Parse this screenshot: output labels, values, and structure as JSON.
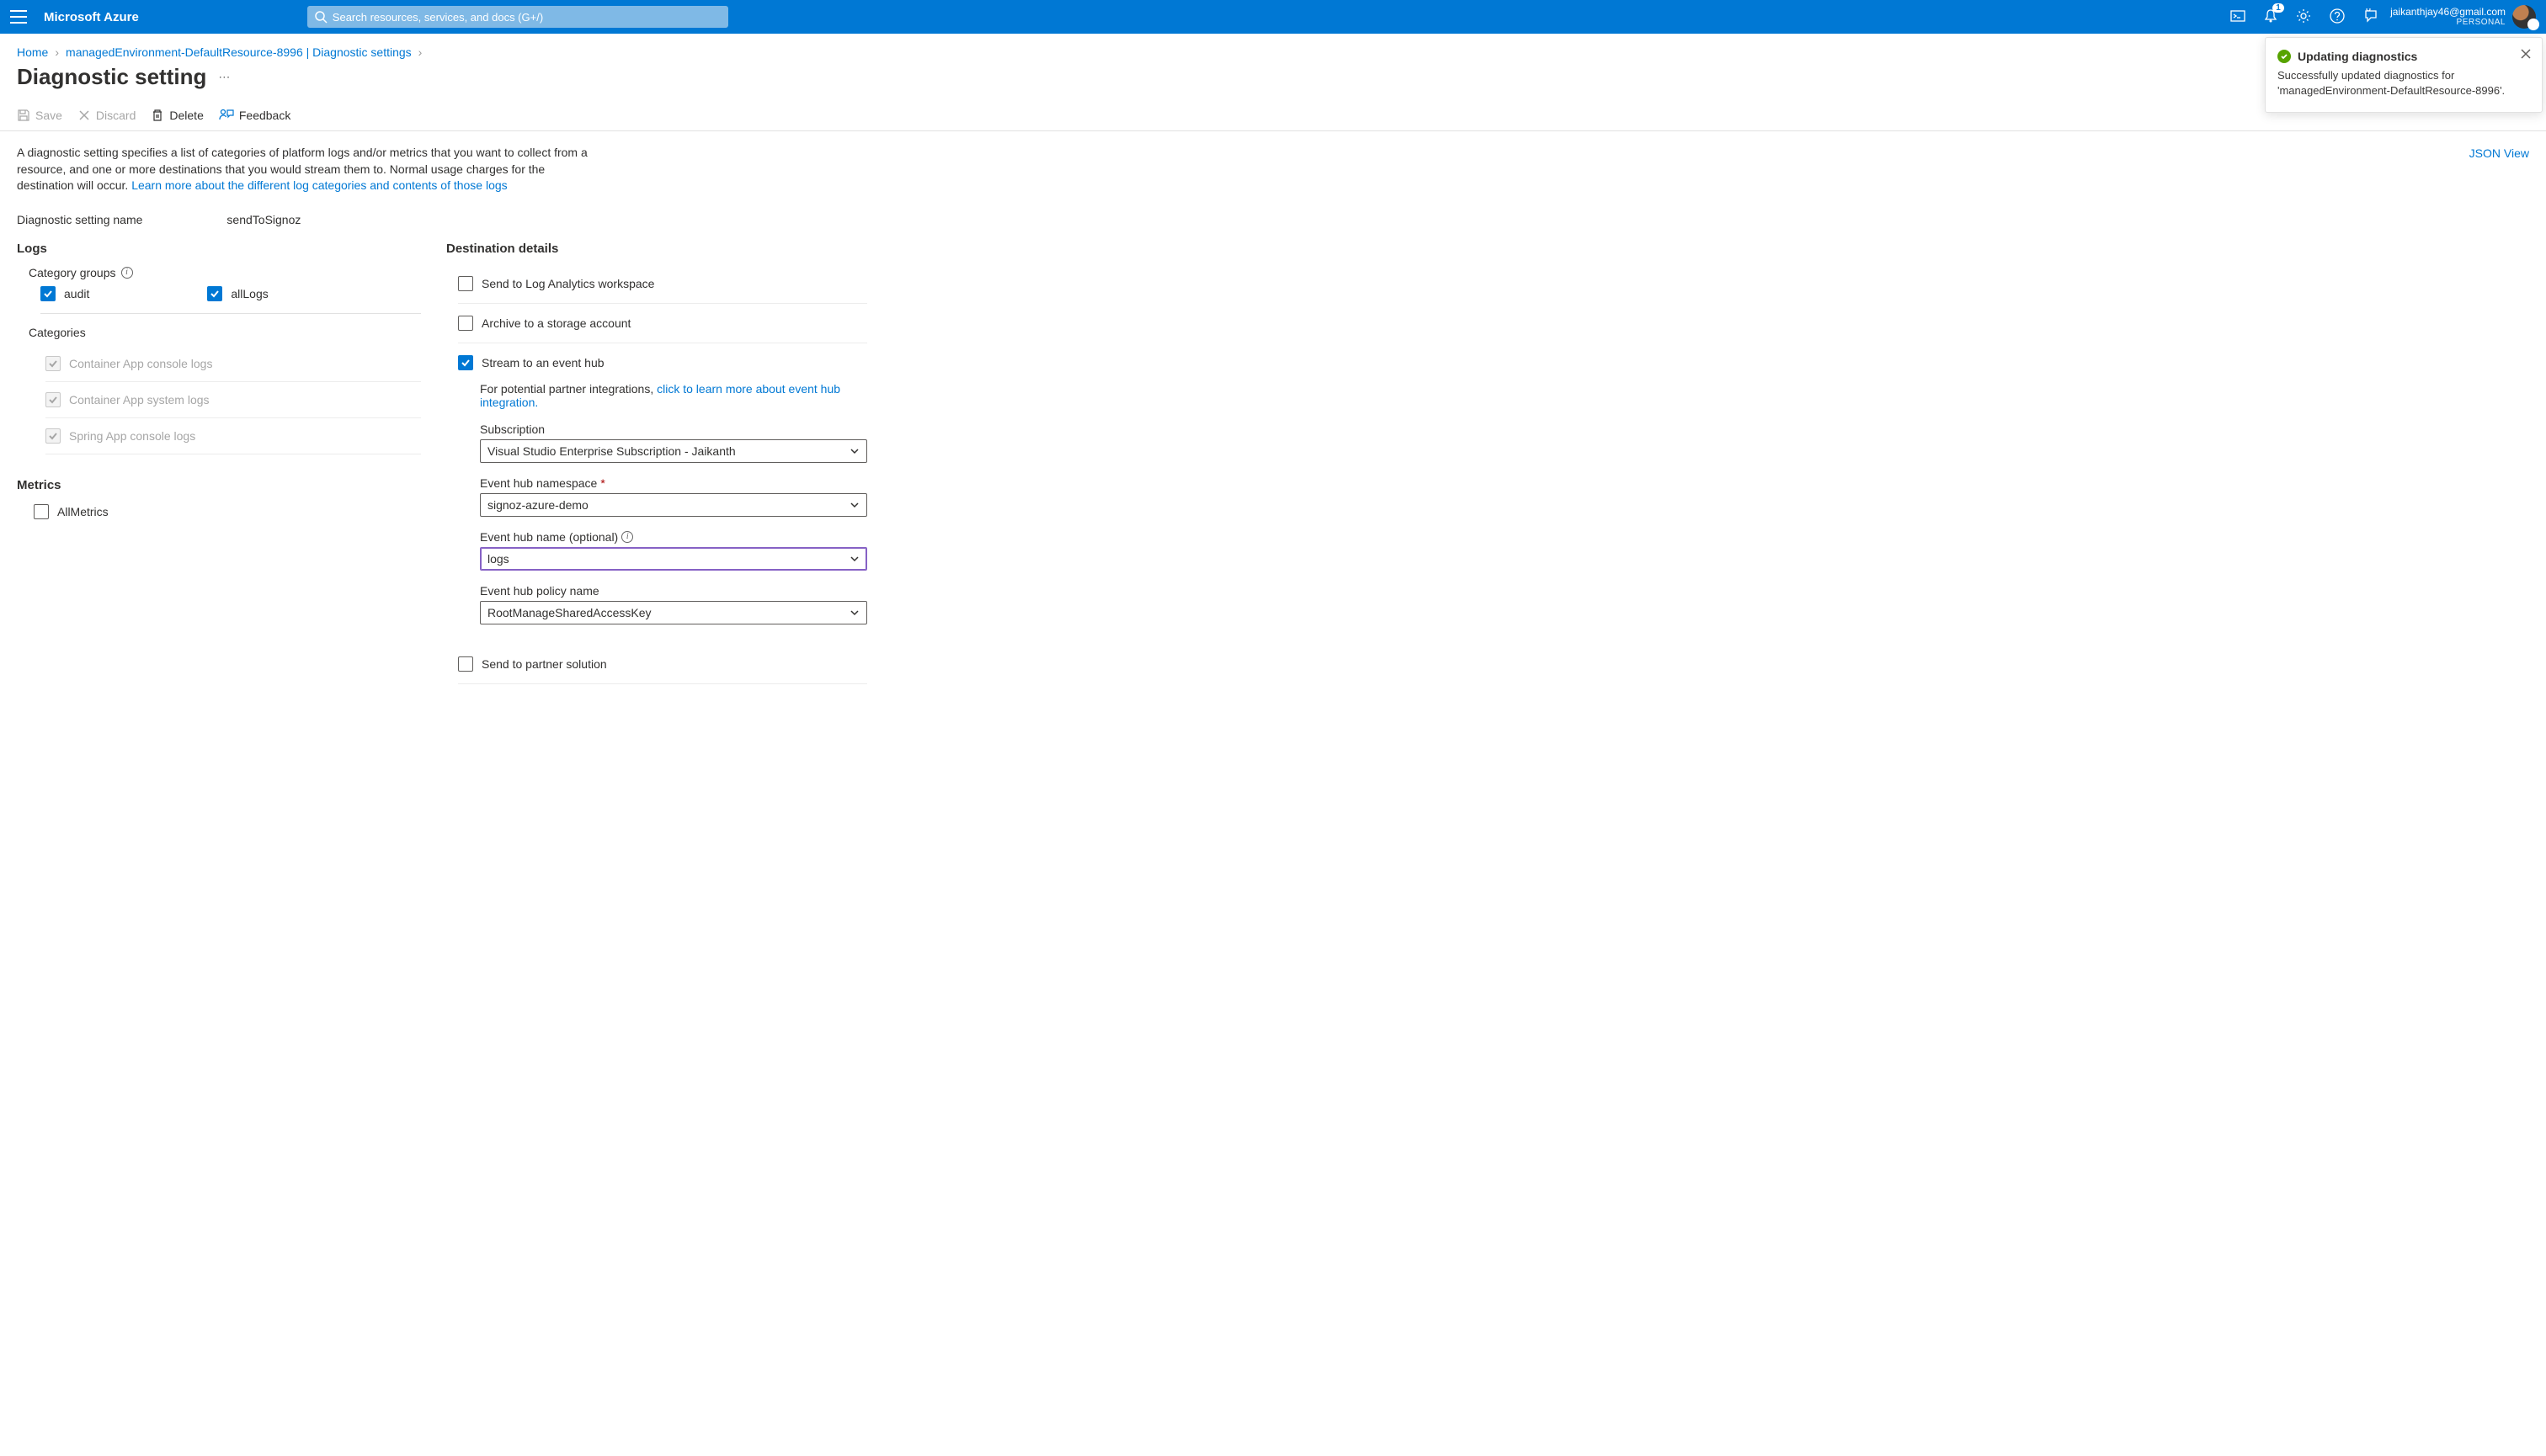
{
  "topbar": {
    "brand": "Microsoft Azure",
    "searchPlaceholder": "Search resources, services, and docs (G+/)",
    "notificationCount": "1",
    "accountEmail": "jaikanthjay46@gmail.com",
    "accountScope": "PERSONAL"
  },
  "breadcrumbs": {
    "home": "Home",
    "resource": "managedEnvironment-DefaultResource-8996 | Diagnostic settings"
  },
  "page": {
    "title": "Diagnostic setting",
    "jsonView": "JSON View"
  },
  "commands": {
    "save": "Save",
    "discard": "Discard",
    "delete": "Delete",
    "feedback": "Feedback"
  },
  "description": {
    "text": "A diagnostic setting specifies a list of categories of platform logs and/or metrics that you want to collect from a resource, and one or more destinations that you would stream them to. Normal usage charges for the destination will occur. ",
    "link": "Learn more about the different log categories and contents of those logs"
  },
  "settingName": {
    "label": "Diagnostic setting name",
    "value": "sendToSignoz"
  },
  "logs": {
    "heading": "Logs",
    "categoryGroupsLabel": "Category groups",
    "groups": [
      {
        "label": "audit",
        "checked": true
      },
      {
        "label": "allLogs",
        "checked": true
      }
    ],
    "categoriesLabel": "Categories",
    "categories": [
      {
        "label": "Container App console logs"
      },
      {
        "label": "Container App system logs"
      },
      {
        "label": "Spring App console logs"
      }
    ]
  },
  "metrics": {
    "heading": "Metrics",
    "item": "AllMetrics"
  },
  "destination": {
    "heading": "Destination details",
    "sendLogAnalytics": "Send to Log Analytics workspace",
    "archiveStorage": "Archive to a storage account",
    "streamEventHub": "Stream to an event hub",
    "sendPartner": "Send to partner solution",
    "partnerText": "For potential partner integrations, ",
    "partnerLink": "click to learn more about event hub integration.",
    "fields": {
      "subscription": {
        "label": "Subscription",
        "value": "Visual Studio Enterprise Subscription - Jaikanth"
      },
      "namespace": {
        "label": "Event hub namespace",
        "value": "signoz-azure-demo"
      },
      "hubName": {
        "label": "Event hub name (optional)",
        "value": "logs"
      },
      "policy": {
        "label": "Event hub policy name",
        "value": "RootManageSharedAccessKey"
      }
    }
  },
  "toast": {
    "title": "Updating diagnostics",
    "body": "Successfully updated diagnostics for 'managedEnvironment-DefaultResource-8996'."
  }
}
